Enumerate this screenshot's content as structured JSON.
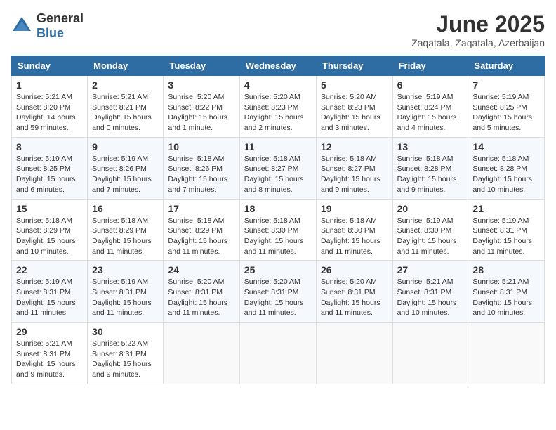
{
  "logo": {
    "general": "General",
    "blue": "Blue"
  },
  "header": {
    "month": "June 2025",
    "location": "Zaqatala, Zaqatala, Azerbaijan"
  },
  "weekdays": [
    "Sunday",
    "Monday",
    "Tuesday",
    "Wednesday",
    "Thursday",
    "Friday",
    "Saturday"
  ],
  "weeks": [
    [
      {
        "day": "1",
        "info": "Sunrise: 5:21 AM\nSunset: 8:20 PM\nDaylight: 14 hours\nand 59 minutes."
      },
      {
        "day": "2",
        "info": "Sunrise: 5:21 AM\nSunset: 8:21 PM\nDaylight: 15 hours\nand 0 minutes."
      },
      {
        "day": "3",
        "info": "Sunrise: 5:20 AM\nSunset: 8:22 PM\nDaylight: 15 hours\nand 1 minute."
      },
      {
        "day": "4",
        "info": "Sunrise: 5:20 AM\nSunset: 8:23 PM\nDaylight: 15 hours\nand 2 minutes."
      },
      {
        "day": "5",
        "info": "Sunrise: 5:20 AM\nSunset: 8:23 PM\nDaylight: 15 hours\nand 3 minutes."
      },
      {
        "day": "6",
        "info": "Sunrise: 5:19 AM\nSunset: 8:24 PM\nDaylight: 15 hours\nand 4 minutes."
      },
      {
        "day": "7",
        "info": "Sunrise: 5:19 AM\nSunset: 8:25 PM\nDaylight: 15 hours\nand 5 minutes."
      }
    ],
    [
      {
        "day": "8",
        "info": "Sunrise: 5:19 AM\nSunset: 8:25 PM\nDaylight: 15 hours\nand 6 minutes."
      },
      {
        "day": "9",
        "info": "Sunrise: 5:19 AM\nSunset: 8:26 PM\nDaylight: 15 hours\nand 7 minutes."
      },
      {
        "day": "10",
        "info": "Sunrise: 5:18 AM\nSunset: 8:26 PM\nDaylight: 15 hours\nand 7 minutes."
      },
      {
        "day": "11",
        "info": "Sunrise: 5:18 AM\nSunset: 8:27 PM\nDaylight: 15 hours\nand 8 minutes."
      },
      {
        "day": "12",
        "info": "Sunrise: 5:18 AM\nSunset: 8:27 PM\nDaylight: 15 hours\nand 9 minutes."
      },
      {
        "day": "13",
        "info": "Sunrise: 5:18 AM\nSunset: 8:28 PM\nDaylight: 15 hours\nand 9 minutes."
      },
      {
        "day": "14",
        "info": "Sunrise: 5:18 AM\nSunset: 8:28 PM\nDaylight: 15 hours\nand 10 minutes."
      }
    ],
    [
      {
        "day": "15",
        "info": "Sunrise: 5:18 AM\nSunset: 8:29 PM\nDaylight: 15 hours\nand 10 minutes."
      },
      {
        "day": "16",
        "info": "Sunrise: 5:18 AM\nSunset: 8:29 PM\nDaylight: 15 hours\nand 11 minutes."
      },
      {
        "day": "17",
        "info": "Sunrise: 5:18 AM\nSunset: 8:29 PM\nDaylight: 15 hours\nand 11 minutes."
      },
      {
        "day": "18",
        "info": "Sunrise: 5:18 AM\nSunset: 8:30 PM\nDaylight: 15 hours\nand 11 minutes."
      },
      {
        "day": "19",
        "info": "Sunrise: 5:18 AM\nSunset: 8:30 PM\nDaylight: 15 hours\nand 11 minutes."
      },
      {
        "day": "20",
        "info": "Sunrise: 5:19 AM\nSunset: 8:30 PM\nDaylight: 15 hours\nand 11 minutes."
      },
      {
        "day": "21",
        "info": "Sunrise: 5:19 AM\nSunset: 8:31 PM\nDaylight: 15 hours\nand 11 minutes."
      }
    ],
    [
      {
        "day": "22",
        "info": "Sunrise: 5:19 AM\nSunset: 8:31 PM\nDaylight: 15 hours\nand 11 minutes."
      },
      {
        "day": "23",
        "info": "Sunrise: 5:19 AM\nSunset: 8:31 PM\nDaylight: 15 hours\nand 11 minutes."
      },
      {
        "day": "24",
        "info": "Sunrise: 5:20 AM\nSunset: 8:31 PM\nDaylight: 15 hours\nand 11 minutes."
      },
      {
        "day": "25",
        "info": "Sunrise: 5:20 AM\nSunset: 8:31 PM\nDaylight: 15 hours\nand 11 minutes."
      },
      {
        "day": "26",
        "info": "Sunrise: 5:20 AM\nSunset: 8:31 PM\nDaylight: 15 hours\nand 11 minutes."
      },
      {
        "day": "27",
        "info": "Sunrise: 5:21 AM\nSunset: 8:31 PM\nDaylight: 15 hours\nand 10 minutes."
      },
      {
        "day": "28",
        "info": "Sunrise: 5:21 AM\nSunset: 8:31 PM\nDaylight: 15 hours\nand 10 minutes."
      }
    ],
    [
      {
        "day": "29",
        "info": "Sunrise: 5:21 AM\nSunset: 8:31 PM\nDaylight: 15 hours\nand 9 minutes."
      },
      {
        "day": "30",
        "info": "Sunrise: 5:22 AM\nSunset: 8:31 PM\nDaylight: 15 hours\nand 9 minutes."
      },
      {
        "day": "",
        "info": ""
      },
      {
        "day": "",
        "info": ""
      },
      {
        "day": "",
        "info": ""
      },
      {
        "day": "",
        "info": ""
      },
      {
        "day": "",
        "info": ""
      }
    ]
  ]
}
